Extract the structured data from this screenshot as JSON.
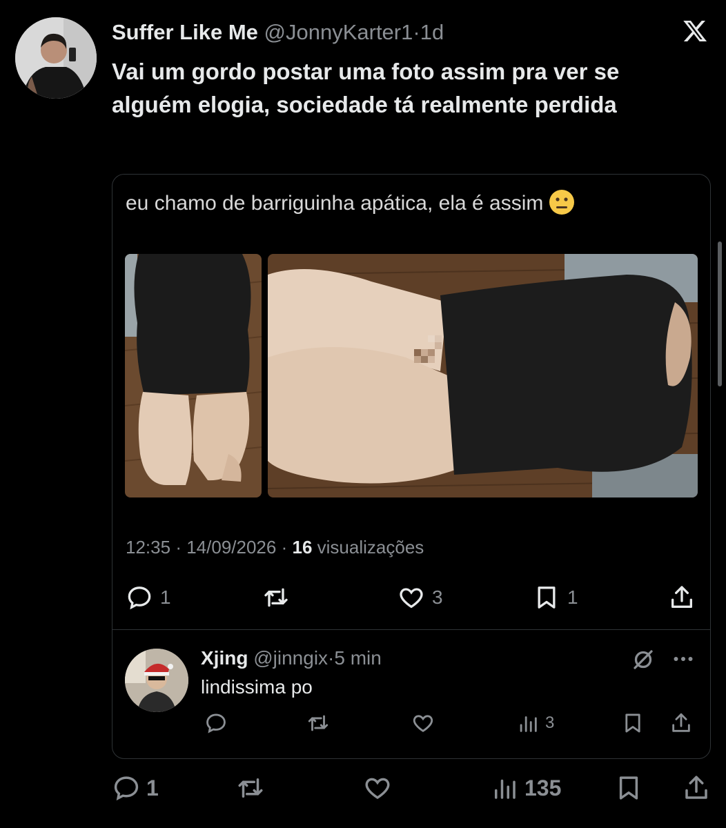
{
  "tweet": {
    "author_name": "Suffer Like Me",
    "handle": "@JonnyKarter1",
    "separator": "·",
    "age": "1d",
    "text": "Vai um gordo postar uma foto assim pra ver se alguém elogia, sociedade tá realmente perdida",
    "icons": {
      "platform": "x-logo-icon",
      "avatar": "avatar"
    },
    "stats": {
      "replies": "1",
      "views": "135"
    }
  },
  "quoted": {
    "text": "eu chamo de barriguinha apática, ela é assim",
    "emoji": "neutral-face-emoji",
    "time": "12:35",
    "date": "14/09/2026",
    "separator": "·",
    "views_count": "16",
    "views_label": "visualizações",
    "stats": {
      "replies": "1",
      "likes": "3",
      "bookmarks": "1"
    }
  },
  "reply": {
    "author_name": "Xjing",
    "handle": "@jinngix",
    "separator": "·",
    "age": "5 min",
    "text": "lindissima po",
    "stats": {
      "views": "3"
    }
  },
  "colors": {
    "background": "#000000",
    "text": "#e7e9ea",
    "muted": "#8b8f94",
    "border": "#2f3336"
  }
}
